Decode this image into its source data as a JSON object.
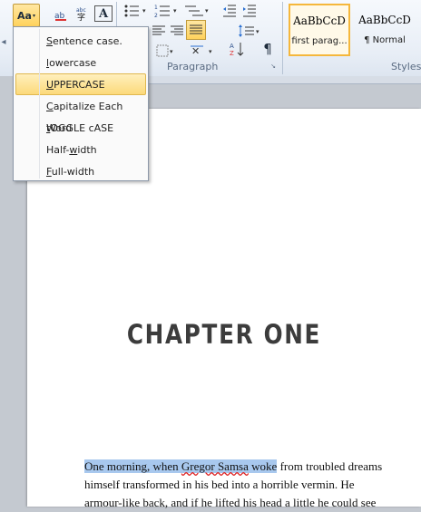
{
  "ribbon": {
    "change_case_label": "Aa",
    "paragraph_group_label": "Paragraph",
    "styles_group_label": "Styles",
    "styles": [
      {
        "sample": "AaBbCcD",
        "name": "first parag..."
      },
      {
        "sample": "AaBbCcD",
        "name": "¶ Normal"
      }
    ],
    "pilcrow": "¶",
    "font_color_glyph": "A"
  },
  "case_menu": {
    "items": [
      {
        "pre": "",
        "key": "S",
        "post": "entence case."
      },
      {
        "pre": "",
        "key": "l",
        "post": "owercase"
      },
      {
        "pre": "",
        "key": "U",
        "post": "PPERCASE"
      },
      {
        "pre": "",
        "key": "C",
        "post": "apitalize Each Word"
      },
      {
        "pre": "",
        "key": "t",
        "post": "OGGLE cASE"
      },
      {
        "pre": "Half-",
        "key": "w",
        "post": "idth"
      },
      {
        "pre": "",
        "key": "F",
        "post": "ull-width"
      }
    ],
    "selected_index": 2
  },
  "document": {
    "chapter_title": "CHAPTER ONE",
    "line1_highlight_a": "One morning, when ",
    "line1_highlight_b": "Gregor Samsa",
    "line1_highlight_c": " woke",
    "line1_rest": " from troubled dreams",
    "line2": "himself transformed in his bed into a horrible vermin. He",
    "line3": "armour-like back, and if he lifted his head a little he could see"
  },
  "colors": {
    "accent": "#ffd25c",
    "highlight": "#a8c8ee",
    "menu_selected": "#fcd97a"
  }
}
